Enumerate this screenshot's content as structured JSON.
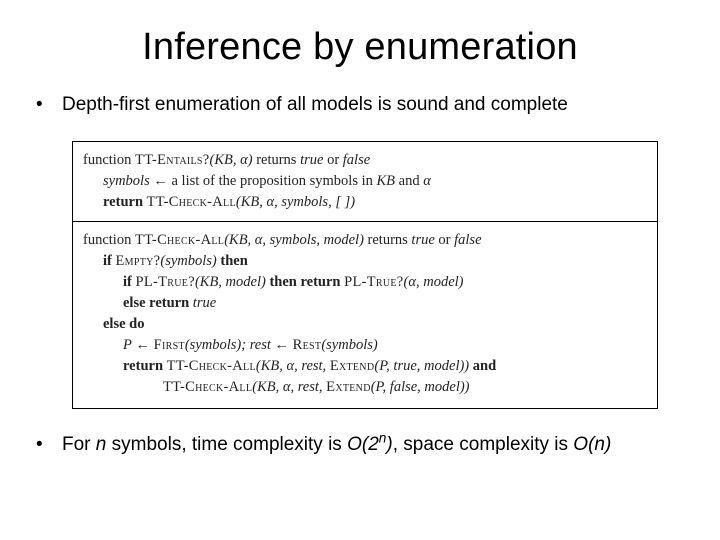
{
  "title": "Inference by enumeration",
  "bullets": {
    "b1": "Depth-first enumeration of all models is sound and complete",
    "b2_pre": "For ",
    "b2_nvar": "n",
    "b2_mid1": " symbols, time complexity is ",
    "b2_O2n_open": "O(2",
    "b2_O2n_exp": "n",
    "b2_O2n_close": ")",
    "b2_mid2": ", space complexity is ",
    "b2_On": "O(n)"
  },
  "algo": {
    "l1_fn": "function ",
    "l1_name": "TT-Entails?",
    "l1_args": "(KB, α) ",
    "l1_ret": "returns ",
    "l1_true": "true",
    "l1_or": " or ",
    "l1_false": "false",
    "l2_lhs": "symbols",
    "l2_arrow": " ← a list of the proposition symbols in ",
    "l2_kb": "KB",
    "l2_and": " and ",
    "l2_alpha": "α",
    "l3_ret": "return ",
    "l3_name": "TT-Check-All",
    "l3_args": "(KB, α, symbols, [ ])",
    "l4_fn": "function ",
    "l4_name": "TT-Check-All",
    "l4_args": "(KB, α, symbols, model) ",
    "l4_ret": "returns ",
    "l4_true": "true",
    "l4_or": " or ",
    "l4_false": "false",
    "l5_if": "if ",
    "l5_empty": "Empty?",
    "l5_args": "(symbols) ",
    "l5_then": "then",
    "l6_if": "if ",
    "l6_pltrue": "PL-True?",
    "l6_args1": "(KB, model) ",
    "l6_then": "then return ",
    "l6_pltrue2": "PL-True?",
    "l6_args2": "(α, model)",
    "l7": "else return ",
    "l7_true": "true",
    "l8": "else do",
    "l9_p": "P",
    "l9_a1": " ← ",
    "l9_first": "First",
    "l9_args1": "(symbols); ",
    "l9_rest_lhs": "rest",
    "l9_a2": " ← ",
    "l9_rest": "Rest",
    "l9_args2": "(symbols)",
    "l10_ret": "return ",
    "l10_name": "TT-Check-All",
    "l10_args": "(KB, α, rest, ",
    "l10_ext": "Extend",
    "l10_extargs": "(P, true, model)) ",
    "l10_and": "and",
    "l11_name": "TT-Check-All",
    "l11_args": "(KB, α, rest, ",
    "l11_ext": "Extend",
    "l11_extargs": "(P, false, model))"
  }
}
